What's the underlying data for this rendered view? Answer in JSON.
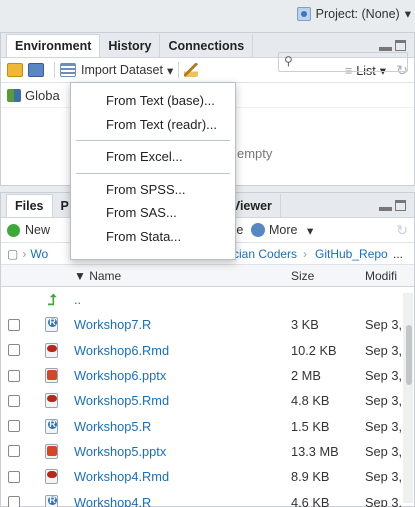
{
  "top": {
    "project_label": "Project: (None)",
    "project_caret": "▾"
  },
  "env_pane": {
    "tabs": [
      "Environment",
      "History",
      "Connections"
    ],
    "toolbar": {
      "import_label": "Import Dataset",
      "import_caret": "▾",
      "list_label": "List",
      "list_caret": "▾",
      "refresh_glyph": "↻",
      "list_glyph": "≡"
    },
    "scope_label": "Global Environment",
    "scope_visible": "Globa",
    "empty_text": "empty",
    "search_glyph": "🔍"
  },
  "import_menu": {
    "groups": [
      [
        "From Text (base)...",
        "From Text (readr)..."
      ],
      [
        "From Excel..."
      ],
      [
        "From SPSS...",
        "From SAS...",
        "From Stata..."
      ]
    ]
  },
  "files_pane": {
    "tabs": [
      "Files",
      "P",
      "Viewer"
    ],
    "toolbar": {
      "new_label": "New",
      "rename_partial": "me",
      "more_label": "More",
      "more_caret": "▾"
    },
    "path": {
      "home_partial": "Wo",
      "crumb1": "cian Coders",
      "sep": "›",
      "crumb2": "GitHub_Repo",
      "more": "..."
    },
    "columns": {
      "name": "▼ Name",
      "size": "Size",
      "modified": "Modifi"
    },
    "parent_label": "..",
    "files": [
      {
        "name": "Workshop7.R",
        "size": "3 KB",
        "modified": "Sep 3,",
        "type": "r"
      },
      {
        "name": "Workshop6.Rmd",
        "size": "10.2 KB",
        "modified": "Sep 3,",
        "type": "rmd"
      },
      {
        "name": "Workshop6.pptx",
        "size": "2 MB",
        "modified": "Sep 3,",
        "type": "pptx"
      },
      {
        "name": "Workshop5.Rmd",
        "size": "4.8 KB",
        "modified": "Sep 3,",
        "type": "rmd"
      },
      {
        "name": "Workshop5.R",
        "size": "1.5 KB",
        "modified": "Sep 3,",
        "type": "r"
      },
      {
        "name": "Workshop5.pptx",
        "size": "13.3 MB",
        "modified": "Sep 3,",
        "type": "pptx"
      },
      {
        "name": "Workshop4.Rmd",
        "size": "8.9 KB",
        "modified": "Sep 3,",
        "type": "rmd"
      },
      {
        "name": "Workshop4.R",
        "size": "4.6 KB",
        "modified": "Sep 3,",
        "type": "r"
      }
    ]
  }
}
